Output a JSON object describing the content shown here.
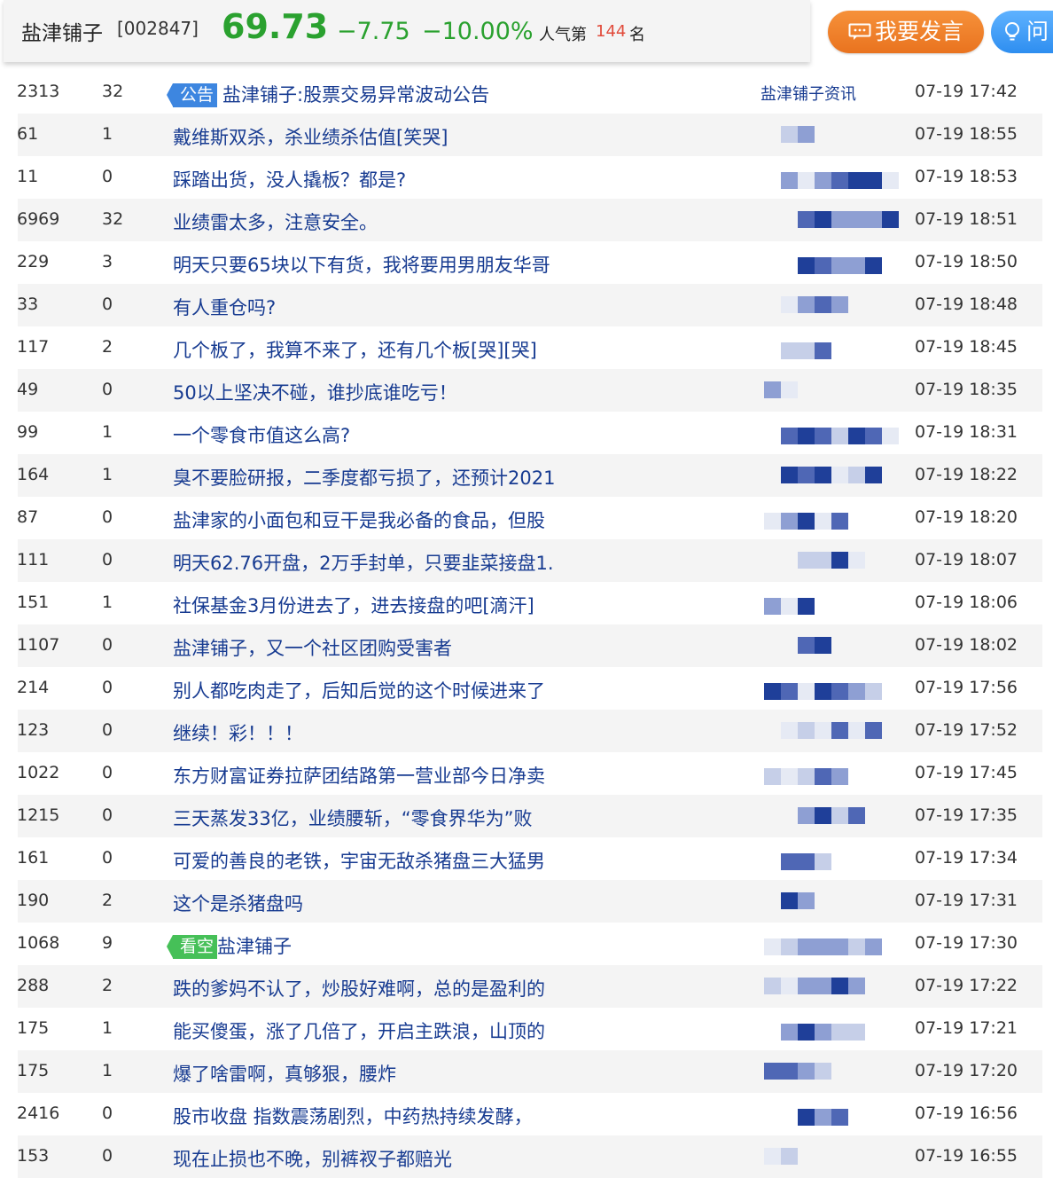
{
  "header": {
    "stock_name": "盐津铺子",
    "stock_code": "[002847]",
    "price": "69.73",
    "change": "−7.75",
    "change_pct": "−10.00%",
    "popularity_label": "人气第",
    "popularity_rank": "144",
    "popularity_unit": "名",
    "post_button": "我要发言",
    "ask_button": "问"
  },
  "colors": {
    "down": "#2aa12f",
    "link": "#173b91",
    "rank": "#e14b3b",
    "post_btn": "#ef8229",
    "ask_btn": "#4aa2f7"
  },
  "rows": [
    {
      "reads": "2313",
      "replies": "32",
      "tag": "公告",
      "title": "盐津铺子:股票交易异常波动公告",
      "author": "盐津铺子资讯",
      "time": "07-19 17:42"
    },
    {
      "reads": "61",
      "replies": "1",
      "tag": "",
      "title": "戴维斯双杀，杀业绩杀估值[笑哭]",
      "author": "",
      "time": "07-19 18:55"
    },
    {
      "reads": "11",
      "replies": "0",
      "tag": "",
      "title": "踩踏出货，没人撬板？都是?",
      "author": "",
      "time": "07-19 18:53"
    },
    {
      "reads": "6969",
      "replies": "32",
      "tag": "",
      "title": "业绩雷太多，注意安全。",
      "author": "",
      "time": "07-19 18:51"
    },
    {
      "reads": "229",
      "replies": "3",
      "tag": "",
      "title": "明天只要65块以下有货，我将要用男朋友华哥",
      "author": "",
      "time": "07-19 18:50"
    },
    {
      "reads": "33",
      "replies": "0",
      "tag": "",
      "title": "有人重仓吗?",
      "author": "",
      "time": "07-19 18:48"
    },
    {
      "reads": "117",
      "replies": "2",
      "tag": "",
      "title": "几个板了，我算不来了，还有几个板[哭][哭]",
      "author": "",
      "time": "07-19 18:45"
    },
    {
      "reads": "49",
      "replies": "0",
      "tag": "",
      "title": "50以上坚决不碰，谁抄底谁吃亏！",
      "author": "",
      "time": "07-19 18:35"
    },
    {
      "reads": "99",
      "replies": "1",
      "tag": "",
      "title": "一个零食市值这么高?",
      "author": "",
      "time": "07-19 18:31"
    },
    {
      "reads": "164",
      "replies": "1",
      "tag": "",
      "title": "臭不要脸研报，二季度都亏损了，还预计2021",
      "author": "",
      "time": "07-19 18:22"
    },
    {
      "reads": "87",
      "replies": "0",
      "tag": "",
      "title": "盐津家的小面包和豆干是我必备的食品，但股",
      "author": "",
      "time": "07-19 18:20"
    },
    {
      "reads": "111",
      "replies": "0",
      "tag": "",
      "title": "明天62.76开盘，2万手封单，只要韭菜接盘1.",
      "author": "",
      "time": "07-19 18:07"
    },
    {
      "reads": "151",
      "replies": "1",
      "tag": "",
      "title": "社保基金3月份进去了，进去接盘的吧[滴汗]",
      "author": "",
      "time": "07-19 18:06"
    },
    {
      "reads": "1107",
      "replies": "0",
      "tag": "",
      "title": "盐津铺子，又一个社区团购受害者",
      "author": "",
      "time": "07-19 18:02"
    },
    {
      "reads": "214",
      "replies": "0",
      "tag": "",
      "title": "别人都吃肉走了，后知后觉的这个时候进来了",
      "author": "",
      "time": "07-19 17:56"
    },
    {
      "reads": "123",
      "replies": "0",
      "tag": "",
      "title": "继续！彩！！！",
      "author": "",
      "time": "07-19 17:52"
    },
    {
      "reads": "1022",
      "replies": "0",
      "tag": "",
      "title": "东方财富证券拉萨团结路第一营业部今日净卖",
      "author": "",
      "time": "07-19 17:45"
    },
    {
      "reads": "1215",
      "replies": "0",
      "tag": "",
      "title": "三天蒸发33亿，业绩腰斩，“零食界华为”败",
      "author": "",
      "time": "07-19 17:35"
    },
    {
      "reads": "161",
      "replies": "0",
      "tag": "",
      "title": "可爱的善良的老铁，宇宙无敌杀猪盘三大猛男",
      "author": "",
      "time": "07-19 17:34"
    },
    {
      "reads": "190",
      "replies": "2",
      "tag": "",
      "title": "这个是杀猪盘吗",
      "author": "",
      "time": "07-19 17:31"
    },
    {
      "reads": "1068",
      "replies": "9",
      "tag": "看空",
      "title": "盐津铺子",
      "author": "",
      "time": "07-19 17:30"
    },
    {
      "reads": "288",
      "replies": "2",
      "tag": "",
      "title": "跌的爹妈不认了，炒股好难啊，总的是盈利的",
      "author": "",
      "time": "07-19 17:22"
    },
    {
      "reads": "175",
      "replies": "1",
      "tag": "",
      "title": "能买傻蛋，涨了几倍了，开启主跌浪，山顶的",
      "author": "",
      "time": "07-19 17:21"
    },
    {
      "reads": "175",
      "replies": "1",
      "tag": "",
      "title": "爆了啥雷啊，真够狠，腰炸",
      "author": "",
      "time": "07-19 17:20"
    },
    {
      "reads": "2416",
      "replies": "0",
      "tag": "",
      "title": "股市收盘 指数震荡剧烈，中药热持续发酵，",
      "author": "",
      "time": "07-19 16:56"
    },
    {
      "reads": "153",
      "replies": "0",
      "tag": "",
      "title": "现在止损也不晚，别裤衩子都赔光",
      "author": "",
      "time": "07-19 16:55"
    }
  ]
}
